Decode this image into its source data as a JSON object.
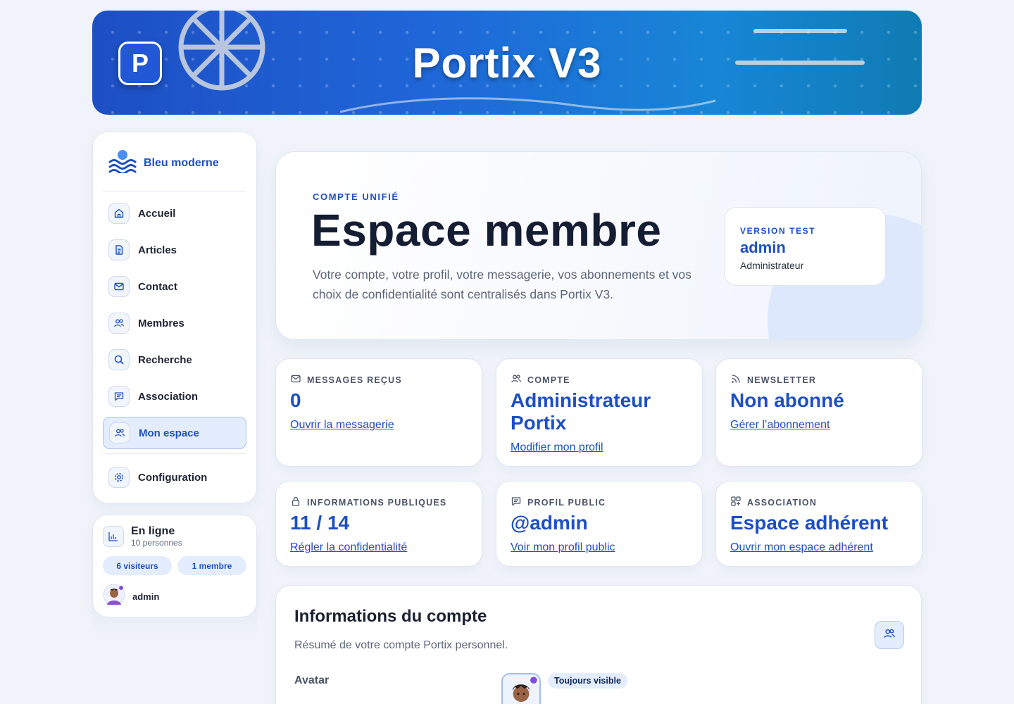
{
  "banner": {
    "title": "Portix V3",
    "logo_letter": "P"
  },
  "sidebar": {
    "brand": "Bleu moderne",
    "items": [
      {
        "label": "Accueil",
        "icon": "home-icon"
      },
      {
        "label": "Articles",
        "icon": "document-icon"
      },
      {
        "label": "Contact",
        "icon": "mail-icon"
      },
      {
        "label": "Membres",
        "icon": "users-icon"
      },
      {
        "label": "Recherche",
        "icon": "search-icon"
      },
      {
        "label": "Association",
        "icon": "chat-icon"
      },
      {
        "label": "Mon espace",
        "icon": "users-icon",
        "active": true
      }
    ],
    "config": {
      "label": "Configuration",
      "icon": "gear-icon"
    }
  },
  "online": {
    "title": "En ligne",
    "subtitle": "10 personnes",
    "visitors": "6 visiteurs",
    "members": "1 membre",
    "user": "admin"
  },
  "hero": {
    "eyebrow": "COMPTE UNIFIÉ",
    "title": "Espace membre",
    "description": "Votre compte, votre profil, votre messagerie, vos abonnements et vos choix de confidentialité sont centralisés dans Portix V3.",
    "version_label": "VERSION TEST",
    "version_user": "admin",
    "version_role": "Administrateur"
  },
  "stats": [
    {
      "label": "MESSAGES REÇUS",
      "value": "0",
      "link": "Ouvrir la messagerie",
      "icon": "mail-icon"
    },
    {
      "label": "COMPTE",
      "value": "Administrateur Portix",
      "link": "Modifier mon profil",
      "icon": "users-icon"
    },
    {
      "label": "NEWSLETTER",
      "value": "Non abonné",
      "link": "Gérer l’abonnement",
      "icon": "rss-icon"
    },
    {
      "label": "INFORMATIONS PUBLIQUES",
      "value": "11 / 14",
      "link": "Régler la confidentialité",
      "icon": "lock-icon"
    },
    {
      "label": "PROFIL PUBLIC",
      "value": "@admin",
      "link": "Voir mon profil public",
      "icon": "chat-icon"
    },
    {
      "label": "ASSOCIATION",
      "value": "Espace adhérent",
      "link": "Ouvrir mon espace adhérent",
      "icon": "grid-icon"
    }
  ],
  "account": {
    "title": "Informations du compte",
    "subtitle": "Résumé de votre compte Portix personnel.",
    "avatar_label": "Avatar",
    "visibility_badge": "Toujours visible"
  },
  "colors": {
    "accent": "#1d4fc4",
    "background": "#f0f4fa",
    "banner_start": "#1d4fc4",
    "banner_end": "#0f7bb3"
  }
}
